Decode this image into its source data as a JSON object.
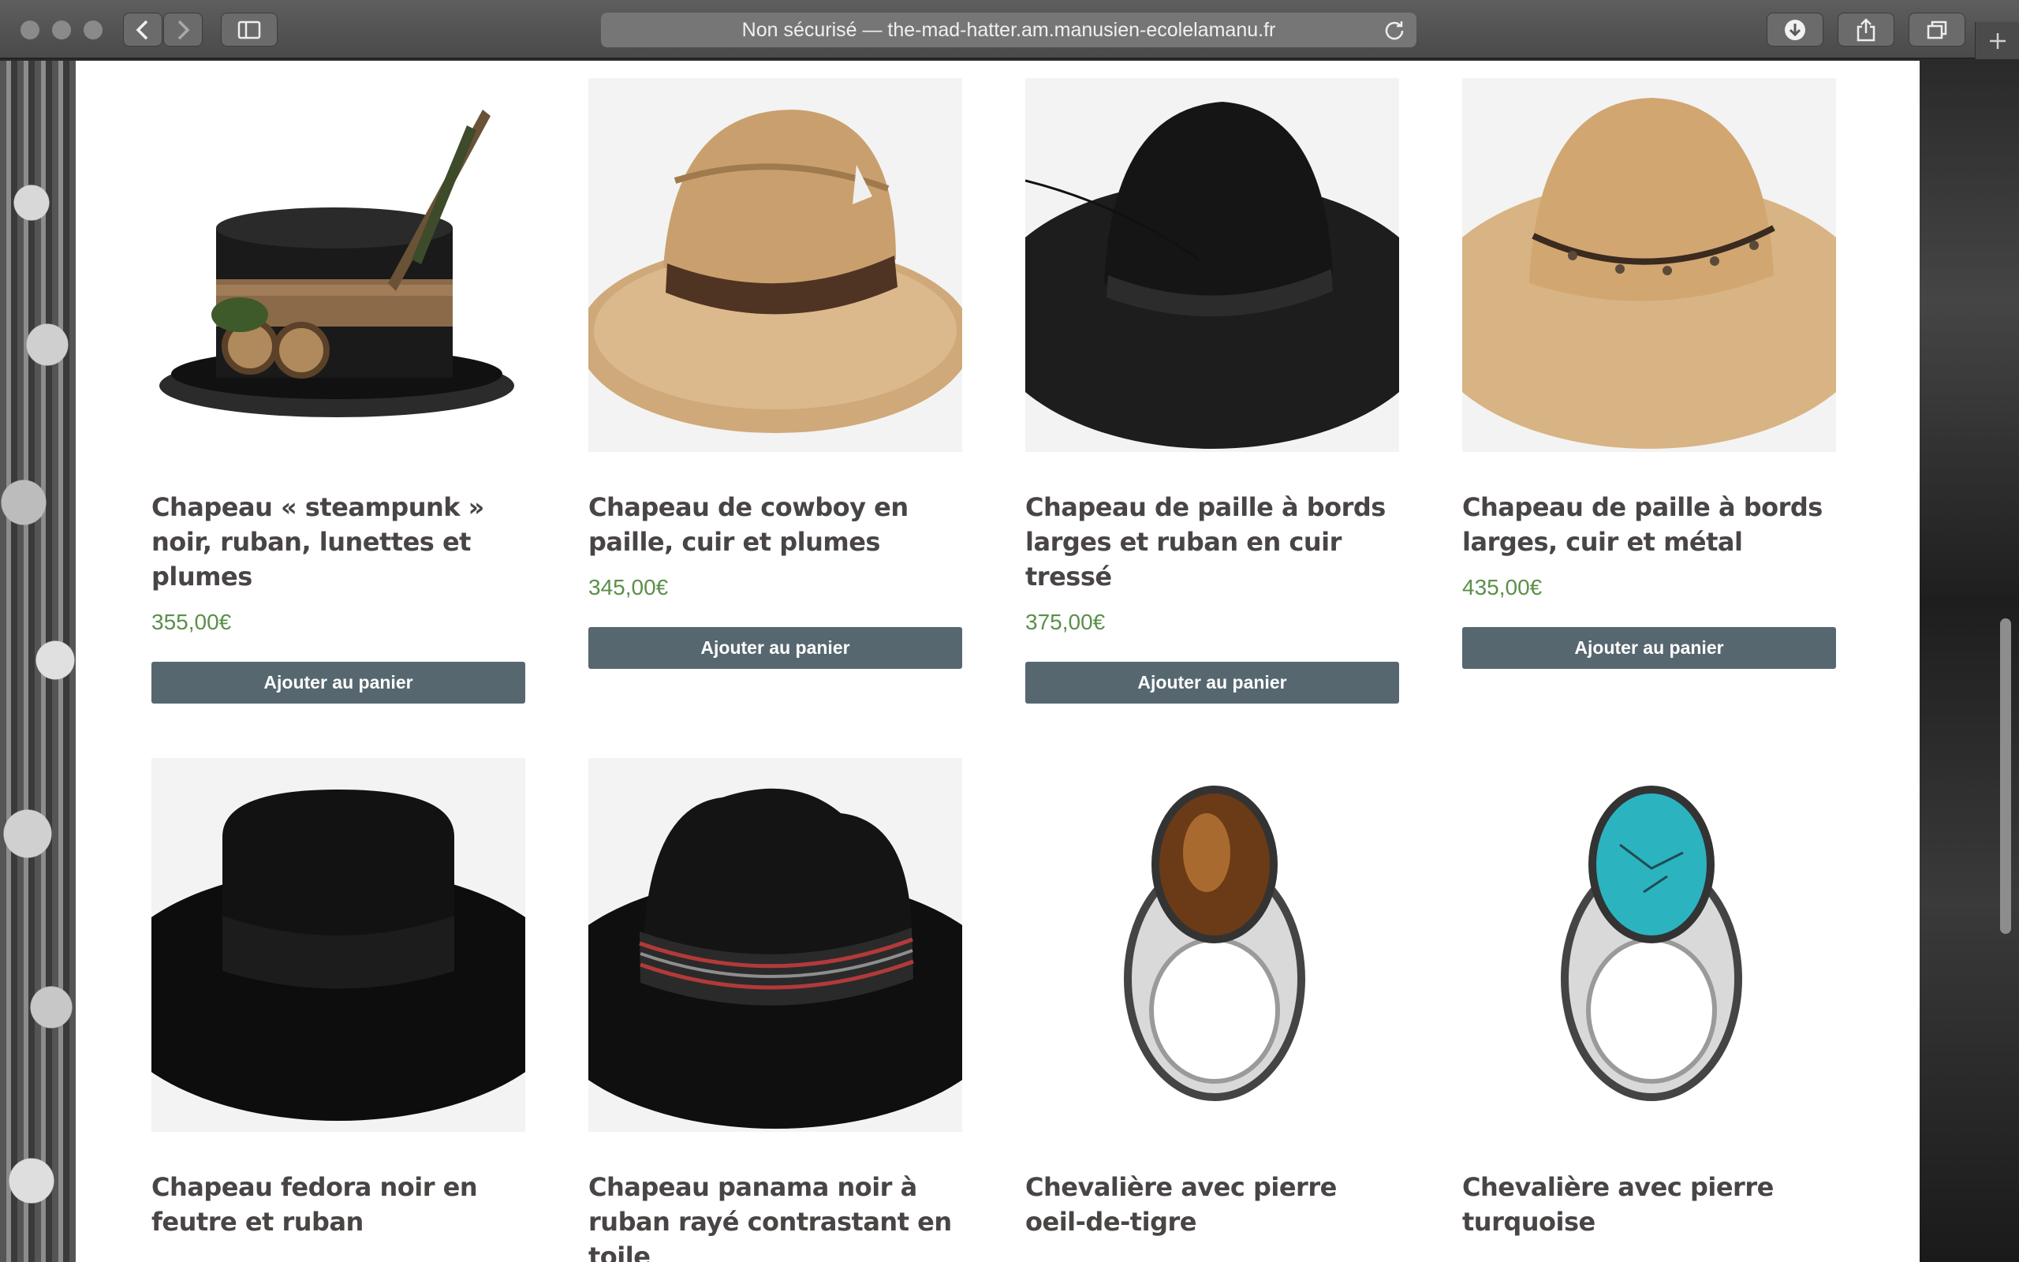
{
  "browser": {
    "address": "Non sécurisé — the-mad-hatter.am.manusien-ecolelamanu.fr"
  },
  "icons": {
    "back": "chevron-left-icon",
    "forward": "chevron-right-icon",
    "sidebar": "sidebar-icon",
    "reload": "reload-icon",
    "download": "download-icon",
    "share": "share-icon",
    "tabs": "tabs-icon",
    "new_tab": "plus-icon"
  },
  "colors": {
    "price": "#5b8f4a",
    "button": "#566770",
    "title": "#4a4545"
  },
  "products": [
    {
      "title": "Chapeau « steampunk » noir, ruban, lunettes et plumes",
      "price": "355,00€",
      "button": "Ajouter au panier"
    },
    {
      "title": "Chapeau de cowboy en paille, cuir et plumes",
      "price": "345,00€",
      "button": "Ajouter au panier"
    },
    {
      "title": "Chapeau de paille à bords larges et ruban en cuir tressé",
      "price": "375,00€",
      "button": "Ajouter au panier"
    },
    {
      "title": "Chapeau de paille à bords larges, cuir et métal",
      "price": "435,00€",
      "button": "Ajouter au panier"
    },
    {
      "title": "Chapeau fedora noir en feutre et ruban"
    },
    {
      "title": "Chapeau panama noir à ruban rayé contrastant en toile"
    },
    {
      "title": "Chevalière avec pierre oeil-de-tigre"
    },
    {
      "title": "Chevalière avec pierre turquoise"
    }
  ]
}
